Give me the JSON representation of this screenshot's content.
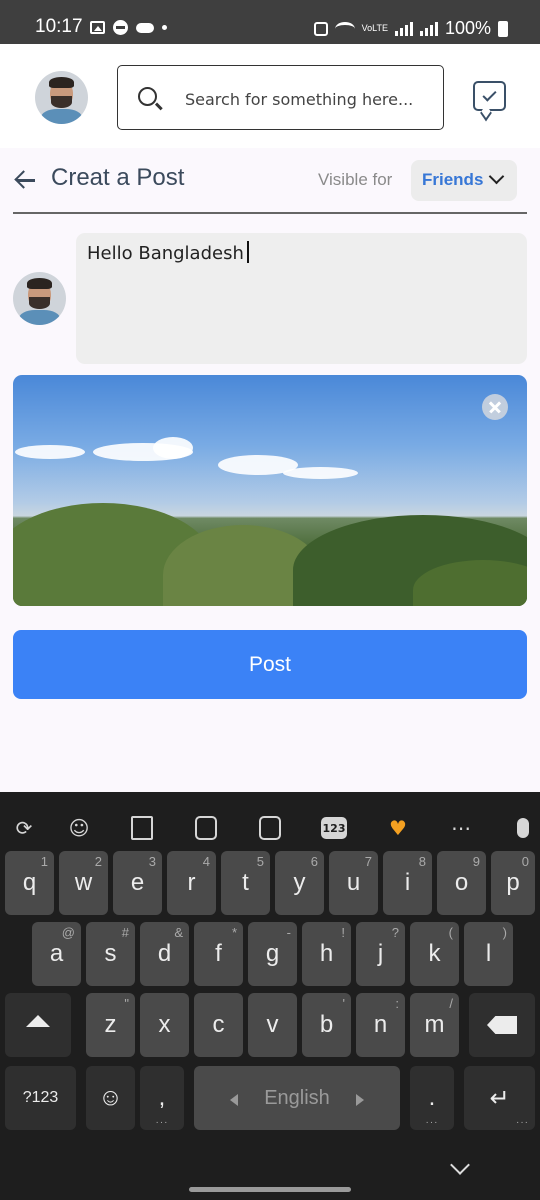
{
  "status_bar": {
    "time": "10:17",
    "battery": "100%",
    "network": "VoLTE"
  },
  "header": {
    "search_placeholder": "Search for something here..."
  },
  "create_post": {
    "title": "Creat a Post",
    "visible_label": "Visible for",
    "visibility_value": "Friends",
    "post_text": "Hello Bangladesh",
    "post_button": "Post"
  },
  "keyboard": {
    "row1": [
      {
        "key": "q",
        "hint": "1"
      },
      {
        "key": "w",
        "hint": "2"
      },
      {
        "key": "e",
        "hint": "3"
      },
      {
        "key": "r",
        "hint": "4"
      },
      {
        "key": "t",
        "hint": "5"
      },
      {
        "key": "y",
        "hint": "6"
      },
      {
        "key": "u",
        "hint": "7"
      },
      {
        "key": "i",
        "hint": "8"
      },
      {
        "key": "o",
        "hint": "9"
      },
      {
        "key": "p",
        "hint": "0"
      }
    ],
    "row2": [
      {
        "key": "a",
        "hint": "@"
      },
      {
        "key": "s",
        "hint": "#"
      },
      {
        "key": "d",
        "hint": "&"
      },
      {
        "key": "f",
        "hint": "*"
      },
      {
        "key": "g",
        "hint": "-"
      },
      {
        "key": "h",
        "hint": "!"
      },
      {
        "key": "j",
        "hint": "?"
      },
      {
        "key": "k",
        "hint": "("
      },
      {
        "key": "l",
        "hint": ")"
      }
    ],
    "row3": [
      {
        "key": "z",
        "hint": "\""
      },
      {
        "key": "x",
        "hint": ""
      },
      {
        "key": "c",
        "hint": ""
      },
      {
        "key": "v",
        "hint": ""
      },
      {
        "key": "b",
        "hint": "'"
      },
      {
        "key": "n",
        "hint": ":"
      },
      {
        "key": "m",
        "hint": "/"
      }
    ],
    "symbols_key": "?123",
    "comma_key": ",",
    "period_key": ".",
    "space_label": "English"
  }
}
